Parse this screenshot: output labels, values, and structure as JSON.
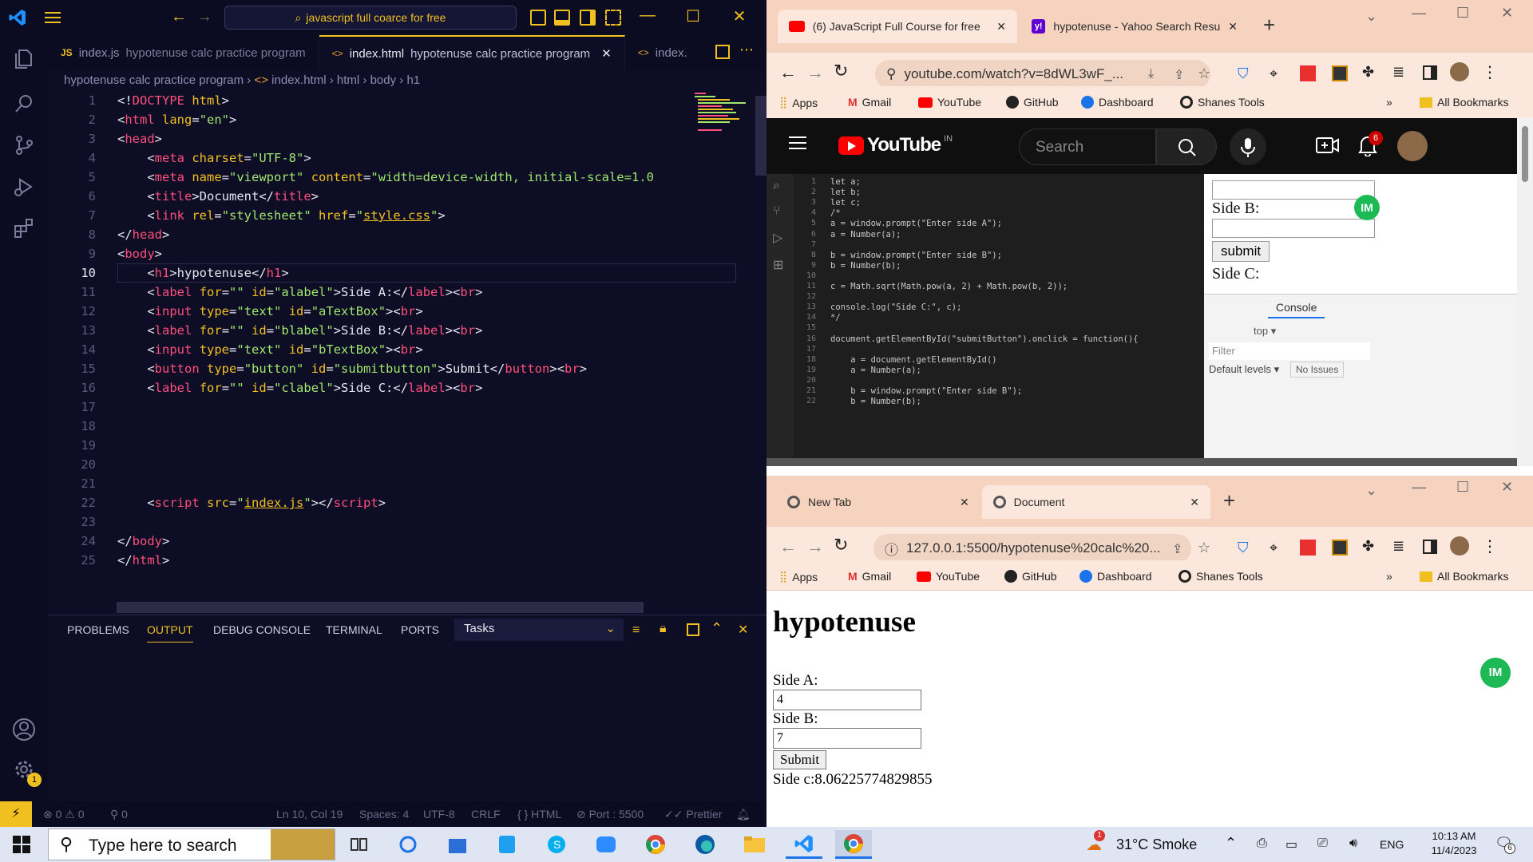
{
  "vscode": {
    "search_text": "javascript full coarce for free",
    "tabs": [
      {
        "icon": "JS",
        "name": "index.js",
        "desc": "hypotenuse calc practice program"
      },
      {
        "icon": "<>",
        "name": "index.html",
        "desc": "hypotenuse calc practice program"
      },
      {
        "icon": "<>",
        "name": "index."
      }
    ],
    "breadcrumb": [
      "hypotenuse calc practice program",
      "index.html",
      "html",
      "body",
      "h1"
    ],
    "line_numbers": [
      "1",
      "2",
      "3",
      "4",
      "5",
      "6",
      "7",
      "8",
      "9",
      "10",
      "11",
      "12",
      "13",
      "14",
      "15",
      "16",
      "17",
      "18",
      "19",
      "20",
      "21",
      "22",
      "23",
      "24",
      "25"
    ],
    "panel_tabs": [
      "PROBLEMS",
      "OUTPUT",
      "DEBUG CONSOLE",
      "TERMINAL",
      "PORTS"
    ],
    "tasks_select": "Tasks",
    "status": {
      "errors": "0",
      "warnings": "0",
      "ports": "0",
      "position": "Ln 10, Col 19",
      "spaces": "Spaces: 4",
      "encoding": "UTF-8",
      "eol": "CRLF",
      "language": "HTML",
      "port": "Port : 5500",
      "prettier": "Prettier",
      "settings_badge": "1"
    }
  },
  "browser_top": {
    "tabs": [
      {
        "title": "(6) JavaScript Full Course for free"
      },
      {
        "title": "hypotenuse - Yahoo Search Resu"
      }
    ],
    "url": "youtube.com/watch?v=8dWL3wF_...",
    "bookmarks": [
      "Apps",
      "Gmail",
      "YouTube",
      "GitHub",
      "Dashboard",
      "Shanes Tools"
    ],
    "all_bookmarks": "All Bookmarks",
    "youtube": {
      "logo_text": "YouTube",
      "region": "IN",
      "search_placeholder": "Search",
      "notif_count": "6"
    },
    "video": {
      "side_b_label": "Side B:",
      "submit_label": "submit",
      "side_c_label": "Side C:",
      "console_tab": "Console",
      "top_select": "top",
      "filter_placeholder": "Filter",
      "levels": "Default levels",
      "issues": "No Issues",
      "extension_label": "IM"
    }
  },
  "browser_bottom": {
    "tabs": [
      {
        "title": "New Tab"
      },
      {
        "title": "Document"
      }
    ],
    "url": "127.0.0.1:5500/hypotenuse%20calc%20...",
    "bookmarks": [
      "Apps",
      "Gmail",
      "YouTube",
      "GitHub",
      "Dashboard",
      "Shanes Tools"
    ],
    "all_bookmarks": "All Bookmarks",
    "page": {
      "heading": "hypotenuse",
      "label_a": "Side A:",
      "value_a": "4",
      "label_b": "Side B:",
      "value_b": "7",
      "submit": "Submit",
      "result": "Side c:8.06225774829855"
    }
  },
  "taskbar": {
    "search_placeholder": "Type here to search",
    "weather": "31°C  Smoke",
    "weather_badge": "1",
    "language": "ENG",
    "time": "10:13 AM",
    "date": "11/4/2023",
    "notification_count": "6"
  }
}
